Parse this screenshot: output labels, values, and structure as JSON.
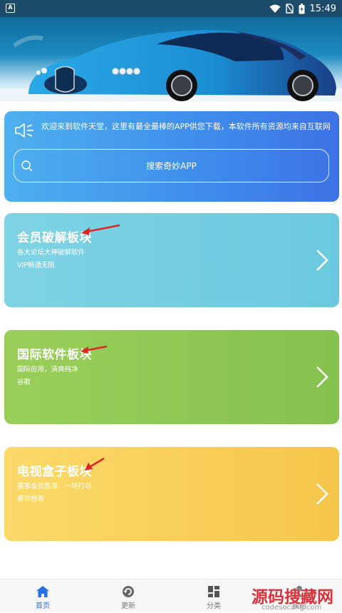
{
  "status_bar": {
    "time": "15:49",
    "app_icon": "A"
  },
  "welcome_text": "欢迎来到软件天堂，这里有最全最棒的APP供您下载，本软件所有资源均来自互联网",
  "search": {
    "label": "搜索奇妙APP"
  },
  "modules": [
    {
      "title": "会员破解板块",
      "line1": "各大论坛大神破解软件",
      "line2": "VIP畅通无阻"
    },
    {
      "title": "国际软件板块",
      "line1": "国际应用，清爽纯净",
      "line2": "谷歌"
    },
    {
      "title": "电视盒子板块",
      "line1": "赛事会员直播，一块打尽",
      "line2": "看你想看"
    }
  ],
  "tabs": [
    {
      "label": "首页",
      "icon": "home-icon",
      "active": true
    },
    {
      "label": "更新",
      "icon": "refresh-icon",
      "active": false
    },
    {
      "label": "分类",
      "icon": "grid-icon",
      "active": false
    },
    {
      "label": "我的",
      "icon": "user-icon",
      "active": false
    }
  ],
  "watermark": {
    "big": "源码搜藏网",
    "small": "codesocang.com"
  },
  "colors": {
    "status_bar": "#1c4c6a",
    "accent": "#2a6fe8",
    "card_blue": "#3f8fec",
    "card_teal": "#6bc9df",
    "card_green": "#8ac652",
    "card_yellow": "#f6c64b",
    "arrow_red": "#e02424"
  }
}
